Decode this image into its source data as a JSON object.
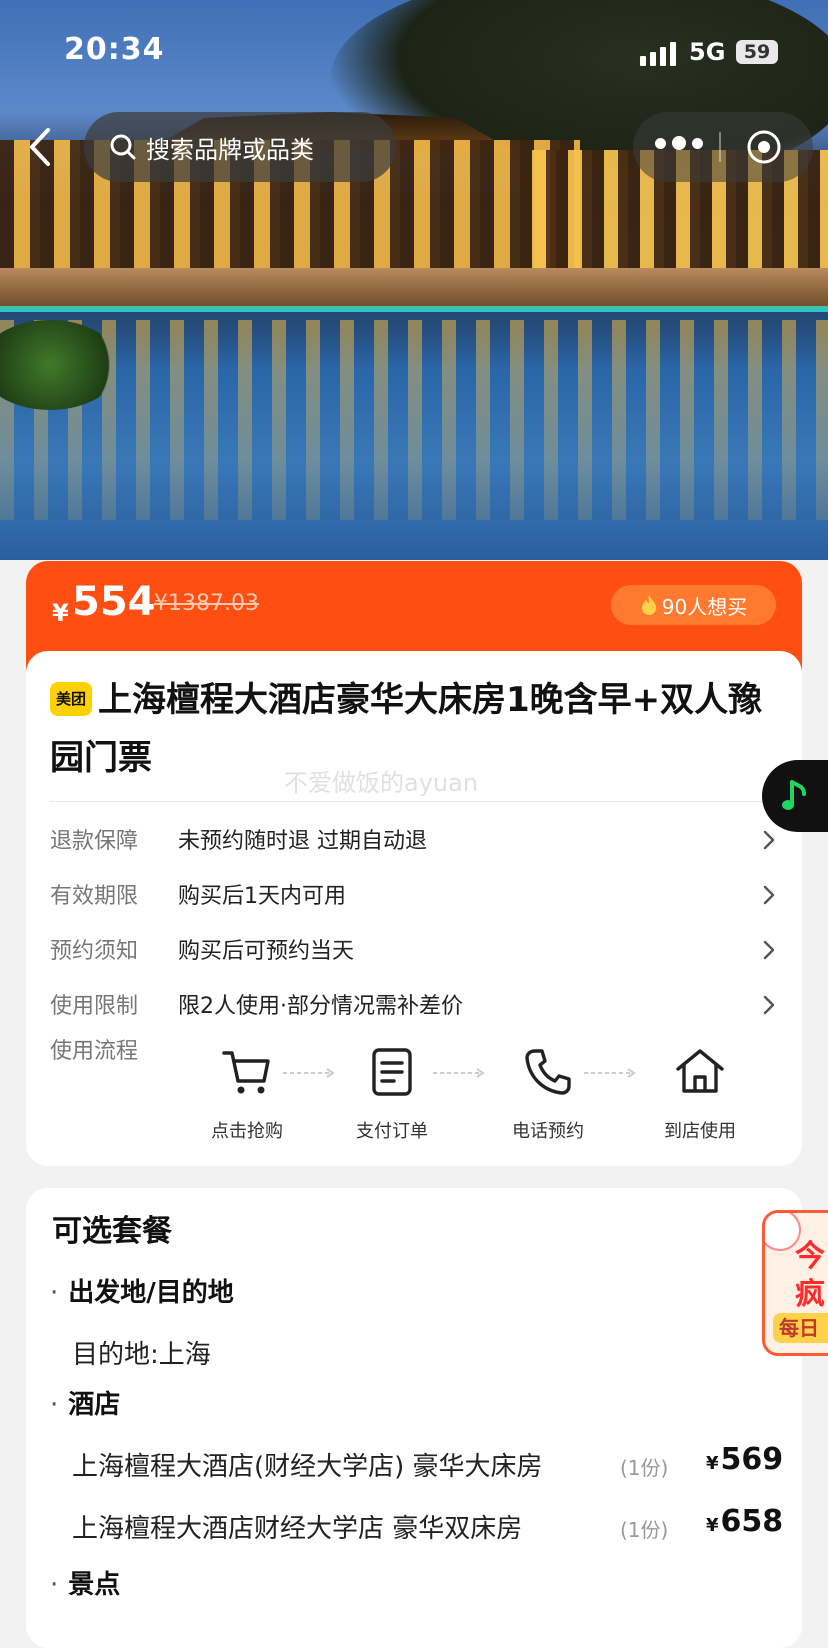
{
  "status_bar": {
    "time": "20:34",
    "network": "5G",
    "battery": "59"
  },
  "search": {
    "placeholder": "搜索品牌或品类"
  },
  "price": {
    "currency": "¥",
    "current": "554",
    "original": "¥1387.03",
    "popularity": "90人想买"
  },
  "product": {
    "brand_badge": "美团",
    "title": "上海檀程大酒店豪华大床房1晚含早+双人豫园门票",
    "watermark": "不爱做饭的ayuan"
  },
  "info_rows": [
    {
      "label": "退款保障",
      "value": "未预约随时退 过期自动退"
    },
    {
      "label": "有效期限",
      "value": "购买后1天内可用"
    },
    {
      "label": "预约须知",
      "value": "购买后可预约当天"
    },
    {
      "label": "使用限制",
      "value": "限2人使用·部分情况需补差价"
    }
  ],
  "usage_flow": {
    "label": "使用流程",
    "steps": [
      {
        "icon": "cart-icon",
        "label": "点击抢购"
      },
      {
        "icon": "document-icon",
        "label": "支付订单"
      },
      {
        "icon": "phone-icon",
        "label": "电话预约"
      },
      {
        "icon": "home-icon",
        "label": "到店使用"
      }
    ]
  },
  "packages": {
    "heading": "可选套餐",
    "sections": [
      {
        "title": "出发地/目的地",
        "lines": [
          "目的地:上海"
        ]
      },
      {
        "title": "酒店",
        "items": [
          {
            "name": "上海檀程大酒店(财经大学店) 豪华大床房",
            "qty": "(1份)",
            "currency": "¥",
            "price": "569"
          },
          {
            "name": "上海檀程大酒店财经大学店 豪华双床房",
            "qty": "(1份)",
            "currency": "¥",
            "price": "658"
          }
        ]
      },
      {
        "title": "景点"
      }
    ]
  },
  "promo": {
    "line1": "今",
    "line2": "疯",
    "line3": "每日"
  },
  "colors": {
    "accent": "#ff4e11",
    "brand_yellow": "#ffd100",
    "music_green": "#1ed760"
  }
}
